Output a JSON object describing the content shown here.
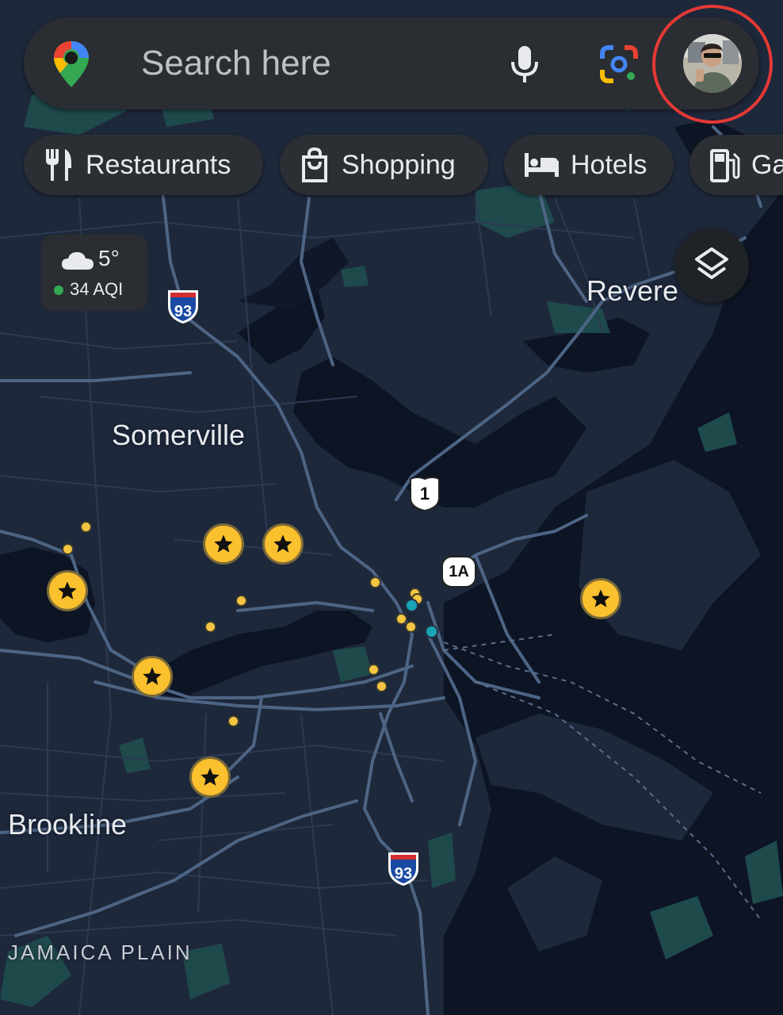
{
  "search": {
    "placeholder": "Search here"
  },
  "chips": [
    {
      "label": "Restaurants",
      "icon": "fork-knife-icon"
    },
    {
      "label": "Shopping",
      "icon": "shopping-bag-icon"
    },
    {
      "label": "Hotels",
      "icon": "bed-icon"
    },
    {
      "label": "Ga",
      "icon": "gas-pump-icon"
    }
  ],
  "weather": {
    "temperature": "5°",
    "aqi": "34 AQI",
    "icon": "cloud-icon"
  },
  "places": {
    "somerville": "Somerville",
    "revere": "Revere",
    "brookline": "Brookline",
    "jamaica_plain": "JAMAICA PLAIN"
  },
  "route_shields": {
    "i93_north": "93",
    "us1": "1",
    "route1a": "1A",
    "i93_south": "93"
  },
  "colors": {
    "map_background": "#1b2538",
    "water": "#0e1526",
    "park": "#1f4a4c",
    "road": "#4d6585",
    "pin_yellow": "#fbc02d",
    "highlight_circle": "#e53935"
  }
}
